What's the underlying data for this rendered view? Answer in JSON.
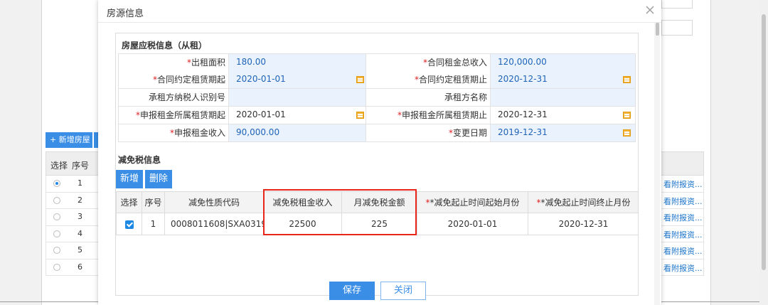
{
  "background": {
    "add_house_label": "+ 新增房屋",
    "table_headers": {
      "select": "选择",
      "index": "序号"
    },
    "rows": [
      {
        "num": "1",
        "selected": true,
        "link": "看附报资..."
      },
      {
        "num": "2",
        "selected": false,
        "link": "看附报资..."
      },
      {
        "num": "3",
        "selected": false,
        "link": "看附报资..."
      },
      {
        "num": "4",
        "selected": false,
        "link": "看附报资..."
      },
      {
        "num": "5",
        "selected": false,
        "link": "看附报资..."
      },
      {
        "num": "6",
        "selected": false,
        "link": "看附报资..."
      }
    ]
  },
  "dialog": {
    "title": "房源信息",
    "tax_section_title": "房屋应税信息（从租）",
    "fields": {
      "rent_area": {
        "label": "出租面积",
        "value": "180.00"
      },
      "contract_total": {
        "label": "合同租金总收入",
        "value": "120,000.00"
      },
      "contract_start": {
        "label": "合同约定租赁期起",
        "value": "2020-01-01"
      },
      "contract_end": {
        "label": "合同约定租赁期止",
        "value": "2020-12-31"
      },
      "tenant_tax_id": {
        "label": "承租方纳税人识别号",
        "value": ""
      },
      "tenant_name": {
        "label": "承租方名称",
        "value": ""
      },
      "declared_start": {
        "label": "申报租金所属租赁期起",
        "value": "2020-01-01"
      },
      "declared_end": {
        "label": "申报租金所属租赁期止",
        "value": "2020-12-31"
      },
      "declared_income": {
        "label": "申报租金收入",
        "value": "90,000.00"
      },
      "change_date": {
        "label": "变更日期",
        "value": "2019-12-31"
      }
    },
    "reduction_section_title": "减免税信息",
    "add_button": "新增",
    "delete_button": "删除",
    "reduction_table": {
      "headers": [
        "选择",
        "序号",
        "减免性质代码",
        "减免税租金收入",
        "月减免税金额",
        "*减免起止时间起始月份",
        "*减免起止时间终止月份"
      ],
      "rows": [
        {
          "index": "1",
          "code": "0008011608|SXA0319...",
          "income": "22500",
          "monthly": "225",
          "start": "2020-01-01",
          "end": "2020-12-31"
        }
      ]
    },
    "save_button": "保存",
    "close_button": "关闭"
  },
  "colors": {
    "primary": "#3a8ee6",
    "required": "#e02020",
    "highlight": "#e8261c",
    "value_text": "#1e63b8"
  }
}
